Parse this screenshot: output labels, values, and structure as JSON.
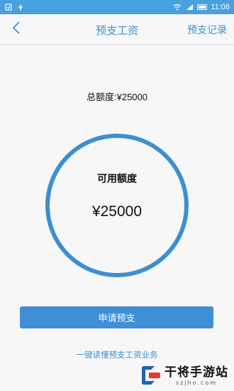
{
  "status_bar": {
    "time": "11:06",
    "icons": [
      "notification-icon",
      "usb-icon",
      "wifi-icon",
      "signal-icon",
      "battery-icon"
    ]
  },
  "nav": {
    "title": "预支工资",
    "right_label": "预支记录",
    "back_icon": "chevron-left-icon"
  },
  "total": {
    "label": "总额度:¥25000"
  },
  "available": {
    "label": "可用额度",
    "amount": "¥25000"
  },
  "apply_button": {
    "label": "申请预支"
  },
  "help_link": {
    "label": "一键读懂预支工资业务"
  },
  "watermark": {
    "text": "干将手游站",
    "sub": "szjho.com"
  },
  "colors": {
    "accent": "#3f8fd6",
    "status_bar": "#47a1df",
    "ring": "#3d8fd1",
    "background": "#f7f7f7"
  }
}
